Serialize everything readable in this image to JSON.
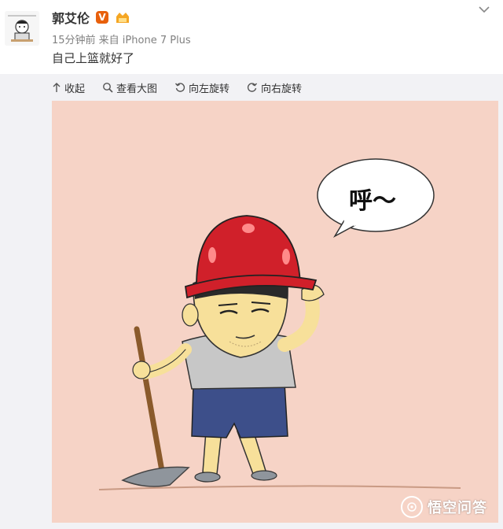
{
  "post": {
    "author_name": "郭艾伦",
    "verified_badge": "V",
    "time_source": "15分钟前 来自 iPhone 7 Plus",
    "text": "自己上篮就好了"
  },
  "toolbar": {
    "collapse": "收起",
    "view_large": "查看大图",
    "rotate_left": "向左旋转",
    "rotate_right": "向右旋转"
  },
  "image": {
    "speech_bubble_text": "呼～",
    "watermark_text": "悟空问答"
  },
  "colors": {
    "image_background": "#f6d3c6",
    "helmet_red": "#d0202a",
    "shirt_gray": "#c7c7c7",
    "shorts_blue": "#3d4f8a",
    "verified_orange": "#e8600c"
  },
  "icons": {
    "collapse": "arrow-up-icon",
    "view_large": "magnifier-icon",
    "rotate_left": "rotate-left-icon",
    "rotate_right": "rotate-right-icon",
    "menu": "chevron-down-icon"
  }
}
